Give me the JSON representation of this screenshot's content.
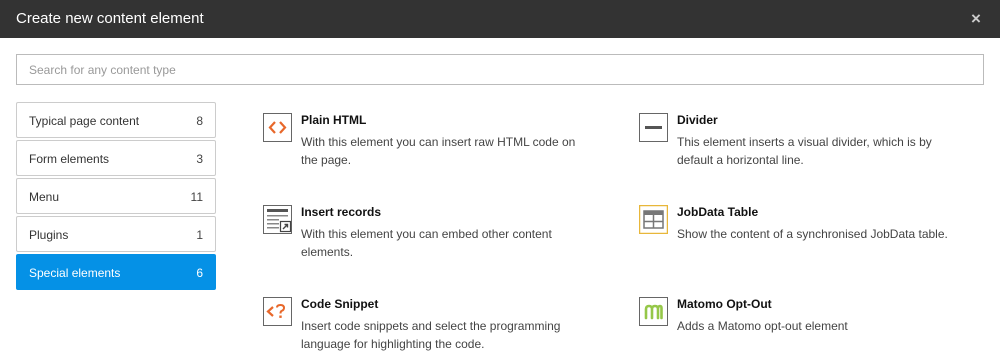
{
  "dialog": {
    "title": "Create new content element",
    "close_label": "×"
  },
  "search": {
    "placeholder": "Search for any content type",
    "value": ""
  },
  "categories": [
    {
      "label": "Typical page content",
      "count": "8",
      "active": false
    },
    {
      "label": "Form elements",
      "count": "3",
      "active": false
    },
    {
      "label": "Menu",
      "count": "11",
      "active": false
    },
    {
      "label": "Plugins",
      "count": "1",
      "active": false
    },
    {
      "label": "Special elements",
      "count": "6",
      "active": true
    }
  ],
  "elements": [
    {
      "name": "Plain HTML",
      "description": "With this element you can insert raw HTML code on the page.",
      "icon": "html-code-icon"
    },
    {
      "name": "Divider",
      "description": "This element inserts a visual divider, which is by default a horizontal line.",
      "icon": "divider-icon"
    },
    {
      "name": "Insert records",
      "description": "With this element you can embed other content elements.",
      "icon": "insert-records-icon"
    },
    {
      "name": "JobData Table",
      "description": "Show the content of a synchronised JobData table.",
      "icon": "table-icon"
    },
    {
      "name": "Code Snippet",
      "description": "Insert code snippets and select the programming language for highlighting the code.",
      "icon": "code-snippet-icon"
    },
    {
      "name": "Matomo Opt-Out",
      "description": "Adds a Matomo opt-out element",
      "icon": "matomo-icon"
    }
  ],
  "colors": {
    "titlebar": "#333333",
    "active_category": "#0591e6",
    "html_icon": "#e8682b",
    "table_icon": "#e8b73a",
    "matomo_icon": "#95c748"
  }
}
